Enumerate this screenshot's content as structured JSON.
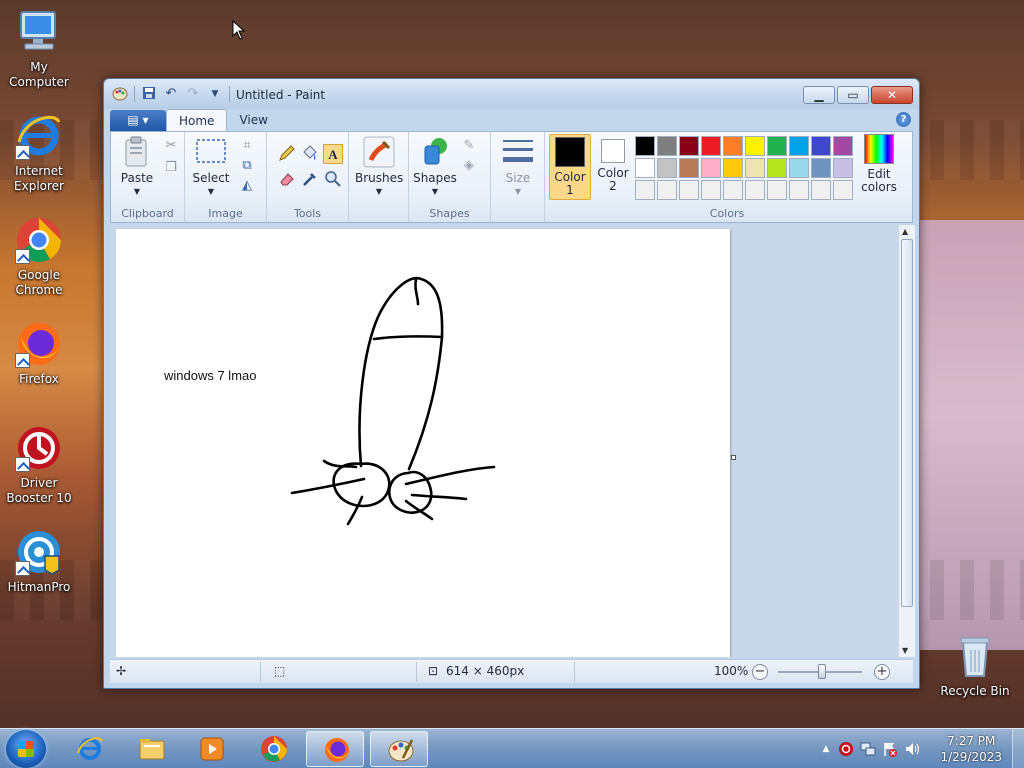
{
  "desktop": {
    "icons": [
      {
        "label": "My Computer",
        "icon": "computer-icon"
      },
      {
        "label": "Internet Explorer",
        "icon": "ie-icon"
      },
      {
        "label": "Google Chrome",
        "icon": "chrome-icon"
      },
      {
        "label": "Firefox",
        "icon": "firefox-icon"
      },
      {
        "label": "Driver Booster 10",
        "icon": "driver-booster-icon"
      },
      {
        "label": "HitmanPro",
        "icon": "hitmanpro-icon"
      },
      {
        "label": "Recycle Bin",
        "icon": "recycle-bin-icon"
      }
    ]
  },
  "window": {
    "title": "Untitled - Paint",
    "tabs": [
      "Home",
      "View"
    ],
    "active_tab": "Home",
    "file_menu_label": "",
    "help": "?"
  },
  "ribbon": {
    "groups": {
      "clipboard": {
        "label": "Clipboard",
        "paste": "Paste"
      },
      "image": {
        "label": "Image",
        "select": "Select"
      },
      "tools": {
        "label": "Tools"
      },
      "brushes": {
        "label": "Brushes"
      },
      "shapes": {
        "label": "Shapes",
        "shapes_btn": "Shapes"
      },
      "size": {
        "label": "Size"
      },
      "colors": {
        "label": "Colors",
        "color1_label": "Color\n1",
        "color1_line1": "Color",
        "color1_line2": "1",
        "color2_line1": "Color",
        "color2_line2": "2",
        "edit_line1": "Edit",
        "edit_line2": "colors",
        "color1": "#000000",
        "color2": "#ffffff",
        "palette_row1": [
          "#000000",
          "#7f7f7f",
          "#880015",
          "#ed1c24",
          "#ff7f27",
          "#fff200",
          "#22b14c",
          "#00a2e8",
          "#3f48cc",
          "#a349a4"
        ],
        "palette_row2": [
          "#ffffff",
          "#c3c3c3",
          "#b97a57",
          "#ffaec9",
          "#ffc90e",
          "#efe4b0",
          "#b5e61d",
          "#99d9ea",
          "#7092be",
          "#c8bfe7"
        ],
        "palette_row3": [
          "#f0f0f0",
          "#f0f0f0",
          "#f0f0f0",
          "#f0f0f0",
          "#f0f0f0",
          "#f0f0f0",
          "#f0f0f0",
          "#f0f0f0",
          "#f0f0f0",
          "#f0f0f0"
        ]
      }
    }
  },
  "canvas": {
    "text": "windows 7 lmao"
  },
  "statusbar": {
    "dimensions": "614 × 460px",
    "zoom": "100%",
    "zoom_out": "−",
    "zoom_in": "+"
  },
  "taskbar": {
    "time": "7:27 PM",
    "date": "1/29/2023",
    "pinned": [
      "ie-icon",
      "explorer-icon",
      "media-player-icon",
      "chrome-icon",
      "firefox-icon",
      "paint-icon"
    ],
    "active": "paint-icon"
  }
}
